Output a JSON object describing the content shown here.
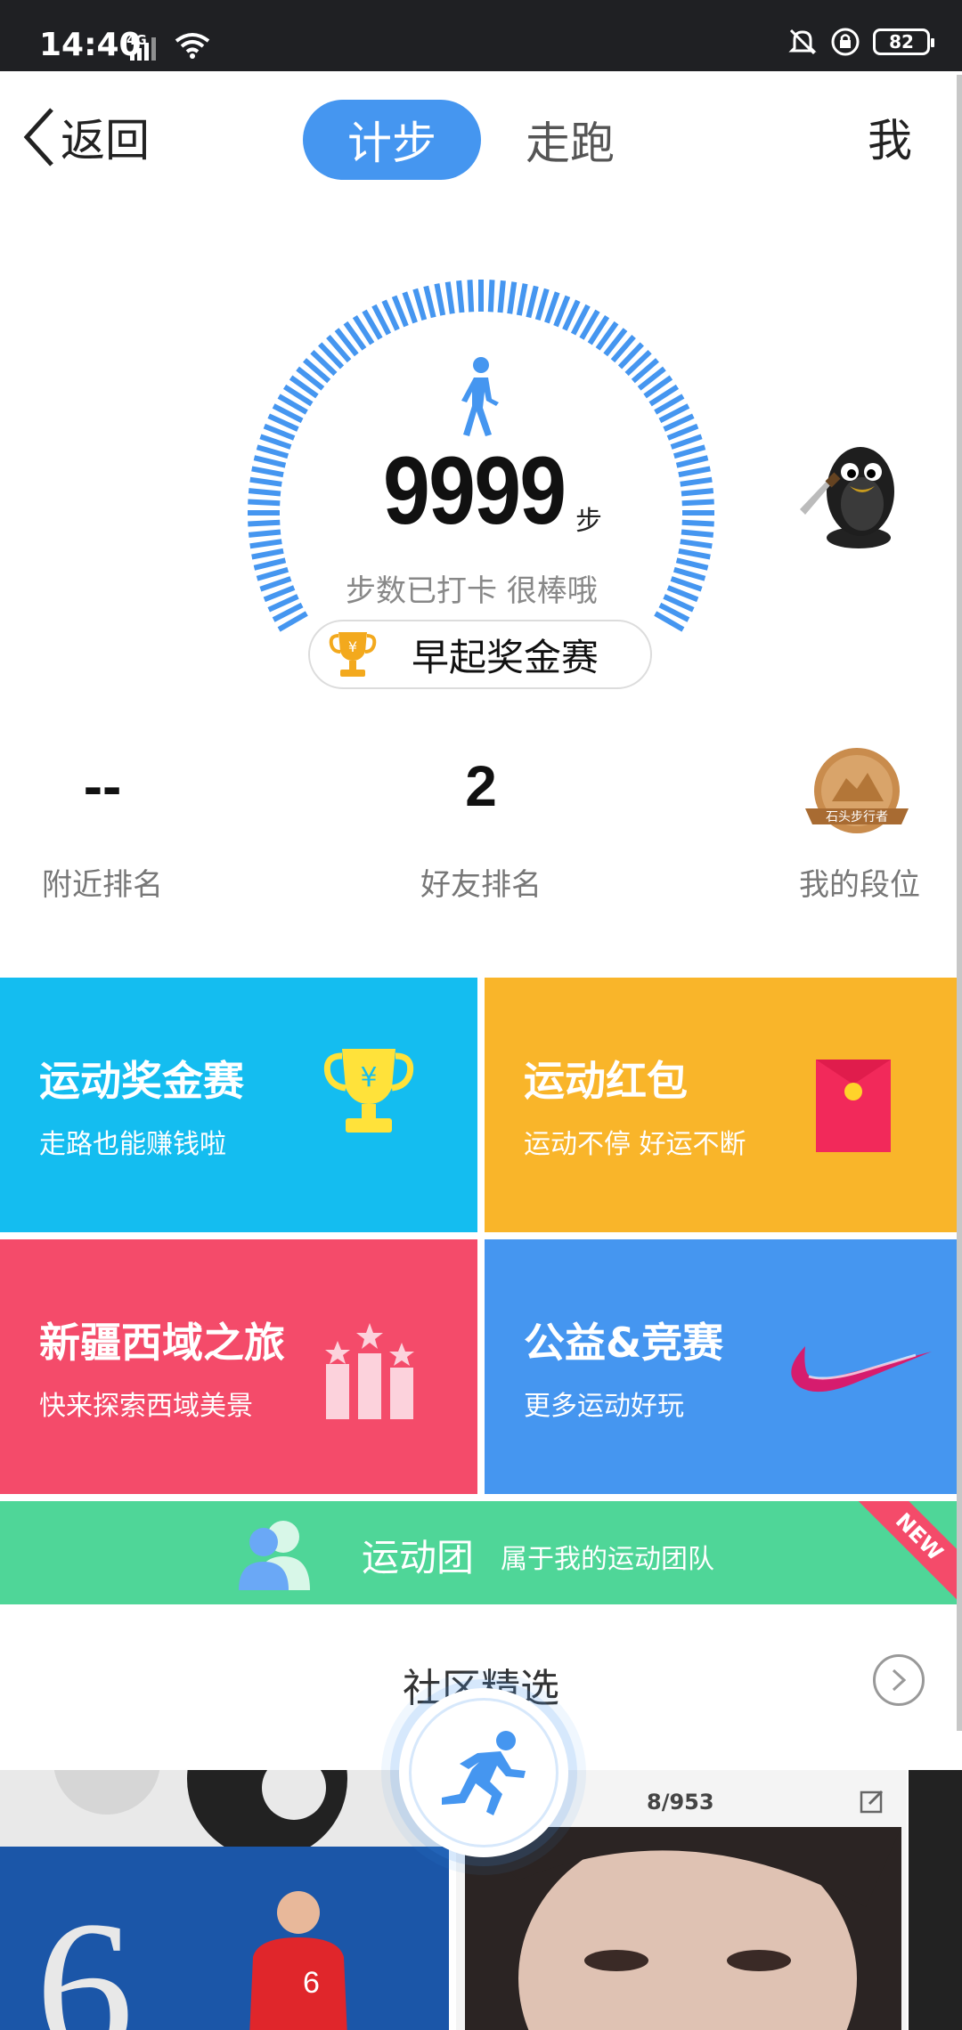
{
  "status_bar": {
    "time": "14:40",
    "network": "4G",
    "battery": "82"
  },
  "nav": {
    "back_label": "返回",
    "tab_step": "计步",
    "tab_run": "走跑",
    "me_label": "我"
  },
  "gauge": {
    "steps": "9999",
    "unit": "步",
    "status": "步数已打卡 很棒哦",
    "early_race": "早起奖金赛"
  },
  "stats": [
    {
      "value": "--",
      "label": "附近排名"
    },
    {
      "value": "2",
      "label": "好友排名"
    },
    {
      "value": "",
      "label": "我的段位"
    }
  ],
  "badge_text": "石头步行者",
  "cards": [
    {
      "title": "运动奖金赛",
      "subtitle": "走路也能赚钱啦",
      "color": "#14bdf0",
      "icon": "trophy-icon"
    },
    {
      "title": "运动红包",
      "subtitle": "运动不停 好运不断",
      "color": "#f9b52a",
      "icon": "red-envelope-icon"
    },
    {
      "title": "新疆西域之旅",
      "subtitle": "快来探索西域美景",
      "color": "#f44b6a",
      "icon": "podium-stars-icon"
    },
    {
      "title": "公益&竞赛",
      "subtitle": "更多运动好玩",
      "color": "#4596f0",
      "icon": "swoosh-icon"
    }
  ],
  "team": {
    "title": "运动团",
    "subtitle": "属于我的运动团队",
    "ribbon": "NEW"
  },
  "community": {
    "title": "社区精选"
  },
  "posts": {
    "counter": "8/953",
    "jersey": "6"
  },
  "colors": {
    "accent": "#4596f0",
    "team_green": "#4fd698"
  }
}
